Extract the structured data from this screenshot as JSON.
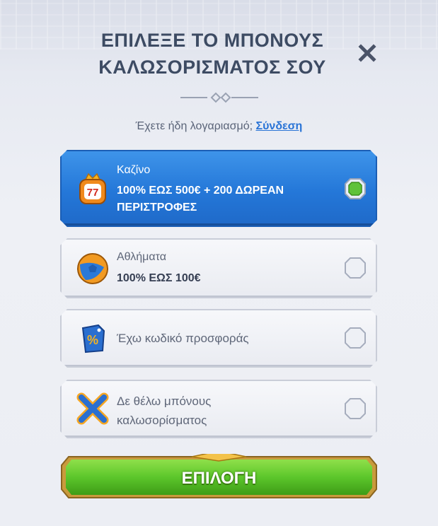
{
  "header": {
    "title_line1": "ΕΠΙΛΕΞΕ ΤΟ ΜΠΟΝΟΥΣ",
    "title_line2": "ΚΑΛΩΣΟΡΙΣΜΑΤΟΣ ΣΟΥ"
  },
  "account": {
    "prompt": "Έχετε ήδη λογαριασμό;",
    "login_link": "Σύνδεση"
  },
  "options": [
    {
      "label": "Καζίνο",
      "title": "100% ΕΩΣ 500€ + 200 ΔΩΡΕΑΝ ΠΕΡΙΣΤΡΟΦΕΣ",
      "icon": "slot-machine-icon",
      "selected": true
    },
    {
      "label": "Αθλήματα",
      "title": "100% ΕΩΣ 100€",
      "icon": "football-icon",
      "selected": false
    },
    {
      "label": "Έχω κωδικό προσφοράς",
      "icon": "promo-code-tag-icon",
      "selected": false
    },
    {
      "label": "Δε θέλω μπόνους καλωσορίσματος",
      "icon": "no-bonus-x-icon",
      "selected": false
    }
  ],
  "submit": {
    "label": "ΕΠΙΛΟΓΗ"
  },
  "colors": {
    "accent_blue": "#2477d8",
    "selected_green": "#5fc23a",
    "button_green": "#5cc62b",
    "title_text": "#3d4b63",
    "link": "#2a74d6"
  }
}
